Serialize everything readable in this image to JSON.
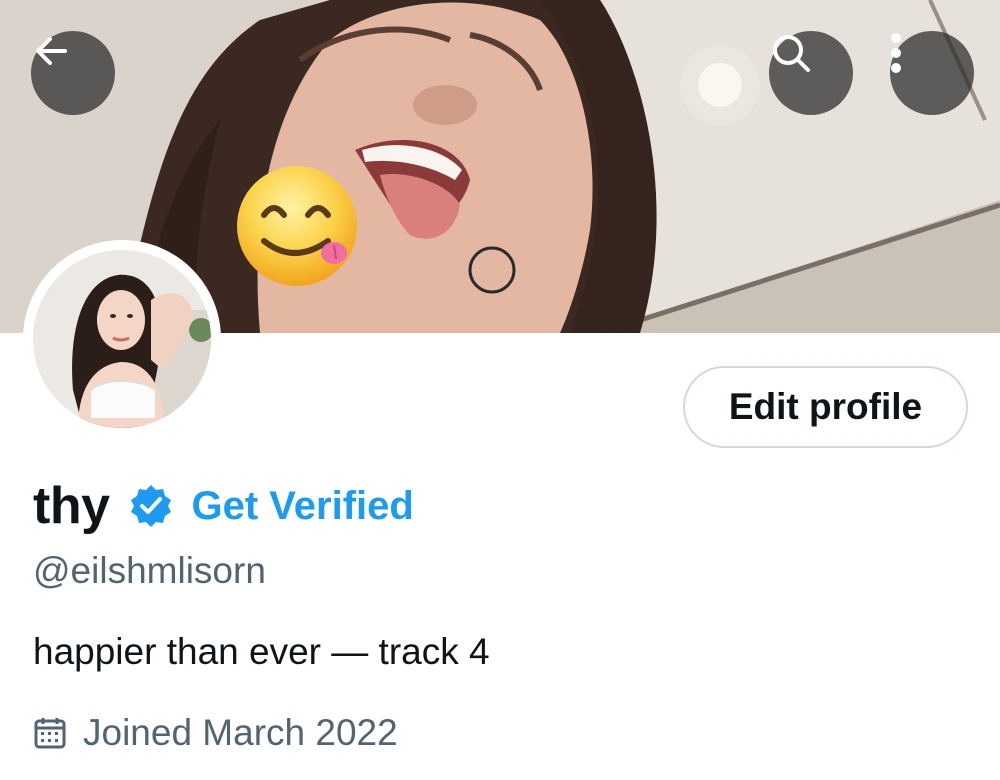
{
  "header": {
    "back_icon": "back-arrow-icon",
    "search_icon": "search-icon",
    "more_icon": "more-vertical-icon"
  },
  "banner": {
    "emoji": "face-savoring-food-emoji"
  },
  "profile": {
    "display_name": "thy",
    "verified_icon": "verified-badge-icon",
    "get_verified_label": "Get Verified",
    "handle": "@eilshmlisorn",
    "bio": "happier than ever — track 4",
    "joined_icon": "calendar-icon",
    "joined_text": "Joined March 2022",
    "edit_profile_label": "Edit profile"
  },
  "colors": {
    "accent": "#1d9bf0",
    "text_primary": "#0f1419",
    "text_secondary": "#536471",
    "button_border": "#cfd9de"
  }
}
